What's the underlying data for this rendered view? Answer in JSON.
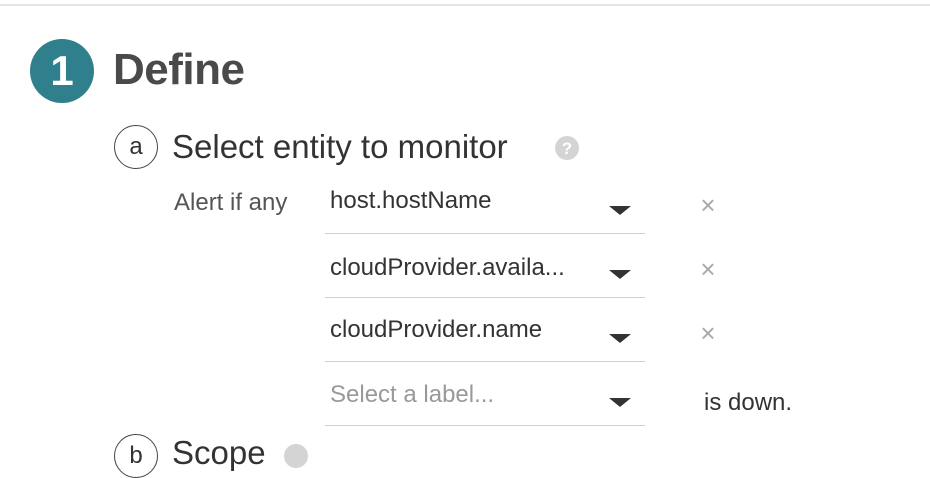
{
  "step": {
    "number": "1",
    "title": "Define"
  },
  "substep": {
    "letter": "a",
    "title": "Select entity to monitor",
    "help_icon": "?"
  },
  "alert": {
    "prefix": "Alert if any",
    "suffix": "is down.",
    "remove_icon": "×",
    "selects": [
      {
        "value": "host.hostName"
      },
      {
        "value": "cloudProvider.availa..."
      },
      {
        "value": "cloudProvider.name"
      }
    ],
    "empty_select_placeholder": "Select a label..."
  },
  "next_substep": {
    "letter": "b",
    "title": "Scope"
  },
  "colors": {
    "accent": "#2f7f8c"
  }
}
